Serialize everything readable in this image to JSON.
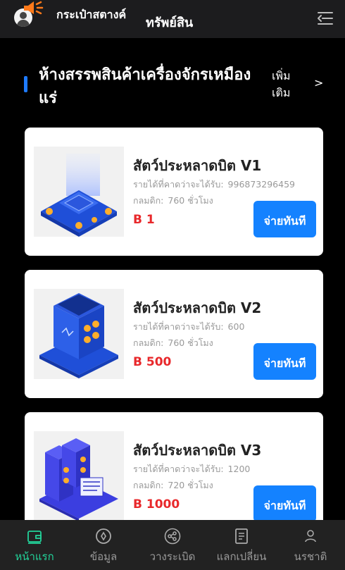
{
  "header": {
    "wallet_label": "กระเป๋าสตางค์",
    "assets_label": "ทรัพย์สิน"
  },
  "section": {
    "title": "ห้างสรรพสินค้าเครื่องจักรเหมืองแร่",
    "more_label": "เพิ่มเติม",
    "more_chevron": ">"
  },
  "labels": {
    "income": "รายได้ที่คาดว่าจะได้รับ:",
    "period": "กลมดิก:",
    "pay": "จ่ายทันที"
  },
  "products": [
    {
      "name": "สัตว์ประหลาดบิต V1",
      "income": "996873296459",
      "period": "760 ชั่วโมง",
      "price": "B 1"
    },
    {
      "name": "สัตว์ประหลาดบิต V2",
      "income": "600",
      "period": "760 ชั่วโมง",
      "price": "B 500"
    },
    {
      "name": "สัตว์ประหลาดบิต V3",
      "income": "1200",
      "period": "720 ชั่วโมง",
      "price": "B 1000"
    }
  ],
  "nav": [
    {
      "label": "หน้าแรก",
      "icon": "wallet-icon",
      "active": true
    },
    {
      "label": "ข้อมูล",
      "icon": "compass-icon",
      "active": false
    },
    {
      "label": "วางระเบิด",
      "icon": "share-icon",
      "active": false
    },
    {
      "label": "แลกเปลี่ยน",
      "icon": "document-icon",
      "active": false
    },
    {
      "label": "นรชาติ",
      "icon": "user-icon",
      "active": false
    }
  ],
  "colors": {
    "accent": "#1e7bff",
    "pay_button": "#1482ff",
    "price": "#e8282b",
    "nav_active": "#22d39a"
  }
}
